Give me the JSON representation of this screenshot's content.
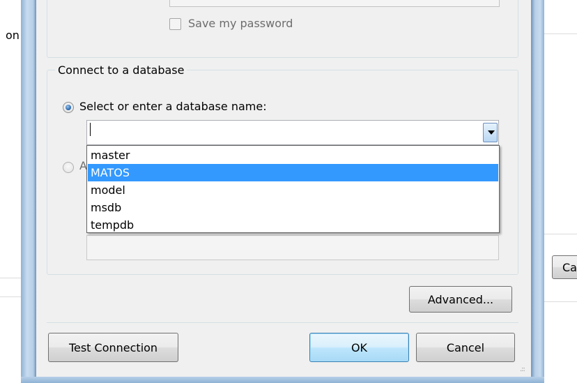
{
  "background_window": {
    "left_fragment": "on",
    "right_button_fragment": "Ca"
  },
  "dialog": {
    "save_password_label": "Save my password",
    "connect_group_title": "Connect to a database",
    "select_db_radio_label": "Select or enter a database name:",
    "database_name_value": "",
    "attach_radio_partial_label": "A",
    "dropdown_options": [
      "master",
      "MATOS",
      "model",
      "msdb",
      "tempdb"
    ],
    "dropdown_selected_option": "MATOS",
    "advanced_button_label": "Advanced...",
    "test_connection_button_label": "Test Connection",
    "ok_button_label": "OK",
    "cancel_button_label": "Cancel",
    "grip_glyph": ".::"
  },
  "colors": {
    "selection_highlight": "#3399ff",
    "frame_blue": "#b7cfe8",
    "dialog_background": "#f0f0f0"
  }
}
